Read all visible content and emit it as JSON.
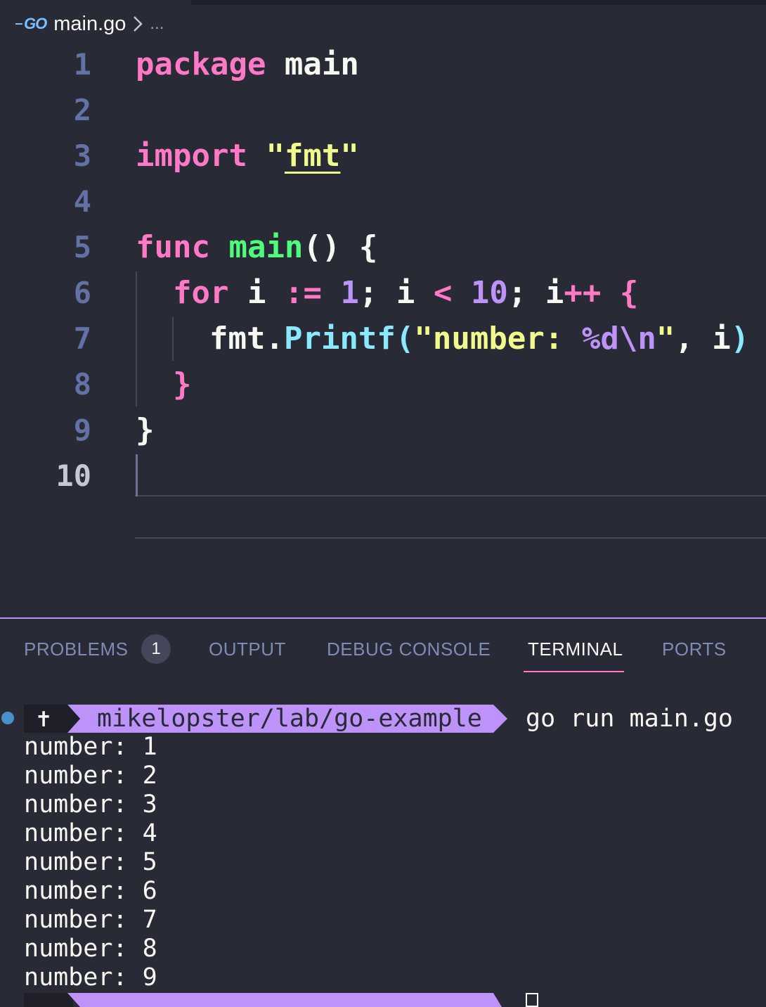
{
  "breadcrumb": {
    "logo_text": "GO",
    "file": "main.go",
    "more": "..."
  },
  "editor": {
    "line_numbers": [
      "1",
      "2",
      "3",
      "4",
      "5",
      "6",
      "7",
      "8",
      "9",
      "10"
    ],
    "active_line": "10",
    "tokens": {
      "l1_kw": "package",
      "l1_id": " main",
      "l3_kw": "import",
      "l3_q1": " \"",
      "l3_str": "fmt",
      "l3_q2": "\"",
      "l5_kw": "func",
      "l5_fn": " main",
      "l5_rest": "() {",
      "l6_kw": "for",
      "l6_a": " i ",
      "l6_op1": ":=",
      "l6_sp": " ",
      "l6_n1": "1",
      "l6_b": "; i ",
      "l6_op2": "<",
      "l6_sp2": " ",
      "l6_n2": "10",
      "l6_c": "; i",
      "l6_op3": "++",
      "l6_sp3": " ",
      "l6_br": "{",
      "l7_pkg": "fmt.",
      "l7_method": "Printf",
      "l7_paren": "(",
      "l7_s1": "\"number: ",
      "l7_fmt": "%d",
      "l7_esc": "\\n",
      "l7_s2": "\"",
      "l7_rest": ", i",
      "l7_close": ")",
      "l8_br": "}",
      "l9_br": "}"
    }
  },
  "panel": {
    "tabs": [
      {
        "label": "PROBLEMS",
        "active": false
      },
      {
        "label": "OUTPUT",
        "active": false
      },
      {
        "label": "DEBUG CONSOLE",
        "active": false
      },
      {
        "label": "TERMINAL",
        "active": true
      },
      {
        "label": "PORTS",
        "active": false
      }
    ],
    "problems_count": "1"
  },
  "terminal": {
    "prompt_symbol": "✝",
    "path": "mikelopster/lab/go-example",
    "command": "go run main.go",
    "output": [
      "number: 1",
      "number: 2",
      "number: 3",
      "number: 4",
      "number: 5",
      "number: 6",
      "number: 7",
      "number: 8",
      "number: 9"
    ]
  },
  "colors": {
    "background": "#282a36",
    "keyword": "#ff79c6",
    "string": "#f1fa8c",
    "function": "#50fa7b",
    "number": "#bd93f9",
    "method": "#8be9fd",
    "prompt_path_bg": "#bd93f9",
    "active_tab_underline": "#ff79c6"
  }
}
